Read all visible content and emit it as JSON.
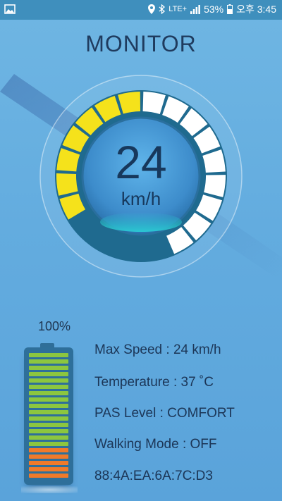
{
  "status_bar": {
    "battery_percent": "53%",
    "time": "오후 3:45",
    "network": "LTE+"
  },
  "header": {
    "title": "MONITOR"
  },
  "gauge": {
    "speed_value": "24",
    "speed_unit": "km/h",
    "total_segments": 16,
    "active_segments": 7,
    "active_color": "#f5e21b",
    "inactive_color": "#ffffff"
  },
  "battery": {
    "level_label": "100%",
    "level": 1.0,
    "green_bars": 15,
    "orange_bars": 5
  },
  "info": {
    "max_speed": "Max Speed : 24 km/h",
    "temperature": "Temperature : 37 ˚C",
    "pas_level": "PAS Level : COMFORT",
    "walking_mode": "Walking Mode : OFF",
    "mac_address": "88:4A:EA:6A:7C:D3"
  },
  "colors": {
    "background": "#63acdf",
    "status_bar": "#3f8fbd",
    "gauge_dark": "#1f6a8f",
    "battery_green": "#8cc63f",
    "battery_orange": "#f07a2a"
  }
}
